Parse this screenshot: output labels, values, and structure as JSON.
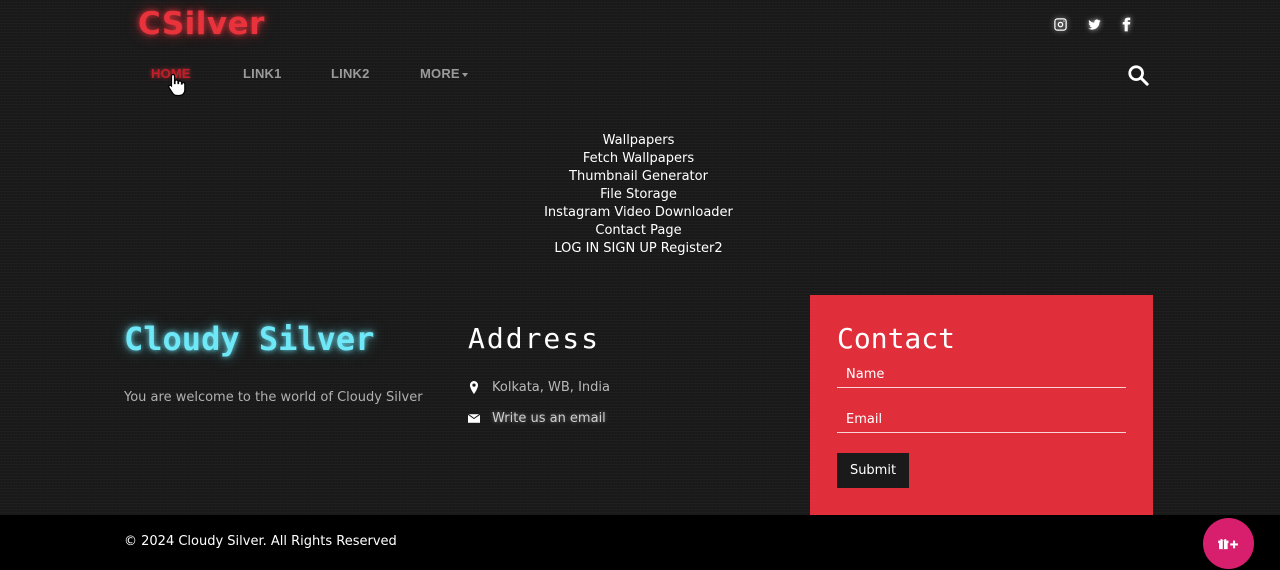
{
  "header": {
    "brand": "CSilver",
    "social": [
      {
        "icon": "instagram-icon"
      },
      {
        "icon": "twitter-icon"
      },
      {
        "icon": "facebook-icon"
      }
    ]
  },
  "nav": {
    "items": [
      {
        "label": "HOME",
        "active": true
      },
      {
        "label": "LINK1",
        "active": false
      },
      {
        "label": "LINK2",
        "active": false
      },
      {
        "label": "MORE",
        "active": false,
        "dropdown": true
      }
    ],
    "search_icon": "search-icon"
  },
  "dropdown": {
    "links": [
      "Wallpapers",
      "Fetch Wallpapers",
      "Thumbnail Generator",
      "File Storage",
      "Instagram Video Downloader",
      "Contact Page",
      "LOG IN SIGN UP Register2"
    ]
  },
  "footer": {
    "title": "Cloudy Silver",
    "description": "You are welcome to the world of Cloudy Silver",
    "address": {
      "title": "Address",
      "location": "Kolkata, WB, India",
      "email_link": "Write us an email"
    },
    "contact": {
      "title": "Contact",
      "name_placeholder": "Name",
      "email_placeholder": "Email",
      "submit_label": "Submit"
    }
  },
  "bottom": {
    "copyright": "© 2024 Cloudy Silver. All Rights Reserved",
    "fab_icon": "gift-plus-icon"
  },
  "colors": {
    "accent_red": "#e02e3a",
    "brand_red": "#e8323c",
    "title_cyan": "#6ee7f7",
    "fab_pink": "#d81f6e"
  }
}
